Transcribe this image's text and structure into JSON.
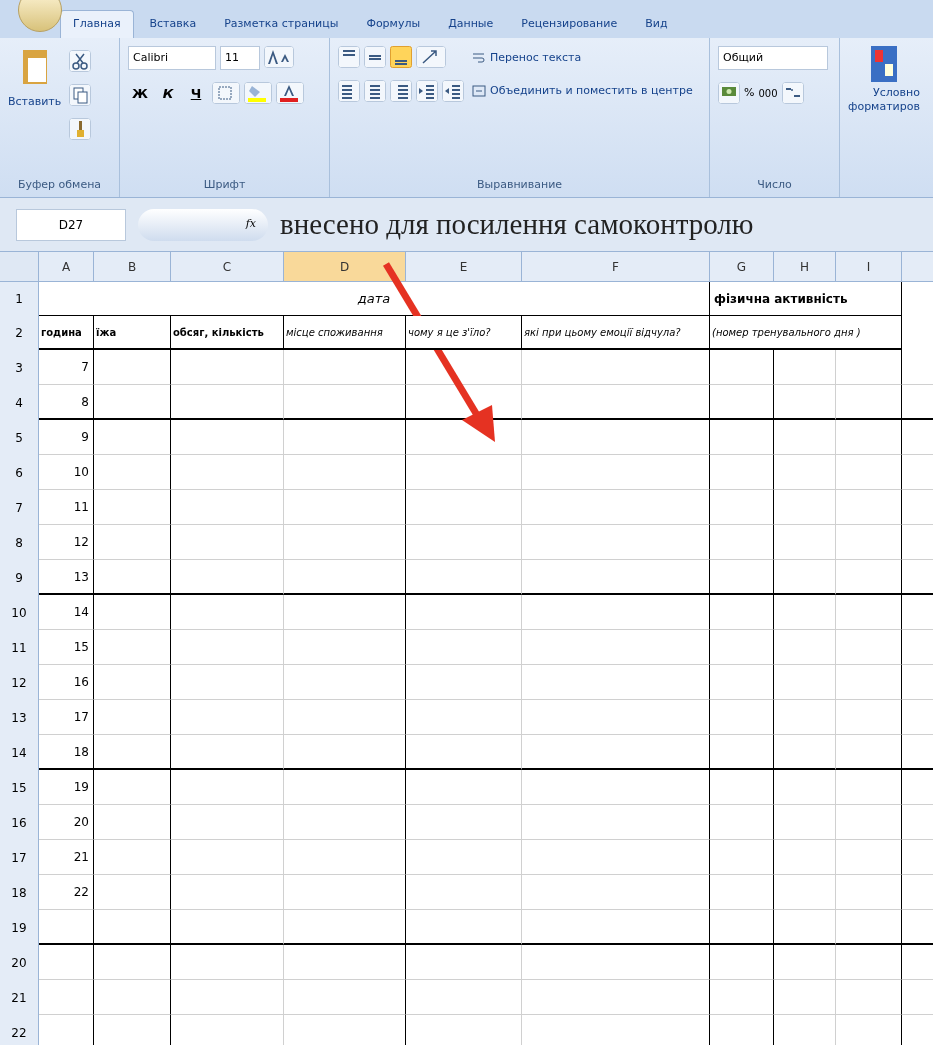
{
  "tabs": [
    {
      "label": "Главная",
      "selected": true
    },
    {
      "label": "Вставка",
      "selected": false
    },
    {
      "label": "Разметка страницы",
      "selected": false
    },
    {
      "label": "Формулы",
      "selected": false
    },
    {
      "label": "Данные",
      "selected": false
    },
    {
      "label": "Рецензирование",
      "selected": false
    },
    {
      "label": "Вид",
      "selected": false
    }
  ],
  "ribbon": {
    "clipboard": {
      "paste": "Вставить",
      "label": "Буфер обмена"
    },
    "font": {
      "name": "Calibri",
      "size": "11",
      "bold": "Ж",
      "italic": "К",
      "underline": "Ч",
      "label": "Шрифт"
    },
    "alignment": {
      "wrap": "Перенос текста",
      "merge": "Объединить и поместить в центре",
      "label": "Выравнивание"
    },
    "number": {
      "format": "Общий",
      "percent": "%",
      "thousands": "000",
      "label": "Число"
    },
    "styles": {
      "conditional": "Условно",
      "conditional_2": "форматиров"
    }
  },
  "formula_bar": {
    "name_box": "D27",
    "fx": "fx"
  },
  "annotation": "внесено для посилення самоконтролю",
  "columns": [
    {
      "label": "A",
      "selected": false
    },
    {
      "label": "B",
      "selected": false
    },
    {
      "label": "C",
      "selected": false
    },
    {
      "label": "D",
      "selected": true
    },
    {
      "label": "E",
      "selected": false
    },
    {
      "label": "F",
      "selected": false
    },
    {
      "label": "G",
      "selected": false
    },
    {
      "label": "H",
      "selected": false
    },
    {
      "label": "I",
      "selected": false
    }
  ],
  "row1": {
    "num": "1",
    "date": "дата",
    "activity": "фізична активність"
  },
  "row2": {
    "num": "2",
    "cells": [
      "година",
      "їжа",
      "обсяг, кількість",
      "місце споживання",
      "чому я це з'їло?",
      "які при цьому емоції відчула?",
      "(номер тренувального дня )"
    ]
  },
  "rows": [
    {
      "num": "3",
      "hour": "7",
      "thick_border": false
    },
    {
      "num": "4",
      "hour": "8",
      "thick_border": true
    },
    {
      "num": "5",
      "hour": "9",
      "thick_border": false
    },
    {
      "num": "6",
      "hour": "10",
      "thick_border": false
    },
    {
      "num": "7",
      "hour": "11",
      "thick_border": false
    },
    {
      "num": "8",
      "hour": "12",
      "thick_border": false
    },
    {
      "num": "9",
      "hour": "13",
      "thick_border": true
    },
    {
      "num": "10",
      "hour": "14",
      "thick_border": false
    },
    {
      "num": "11",
      "hour": "15",
      "thick_border": false
    },
    {
      "num": "12",
      "hour": "16",
      "thick_border": false
    },
    {
      "num": "13",
      "hour": "17",
      "thick_border": false
    },
    {
      "num": "14",
      "hour": "18",
      "thick_border": true
    },
    {
      "num": "15",
      "hour": "19",
      "thick_border": false
    },
    {
      "num": "16",
      "hour": "20",
      "thick_border": false
    },
    {
      "num": "17",
      "hour": "21",
      "thick_border": false
    },
    {
      "num": "18",
      "hour": "22",
      "thick_border": false
    },
    {
      "num": "19",
      "thick_border": true
    },
    {
      "num": "20",
      "thick_border": false
    },
    {
      "num": "21",
      "thick_border": false
    },
    {
      "num": "22"
    }
  ]
}
